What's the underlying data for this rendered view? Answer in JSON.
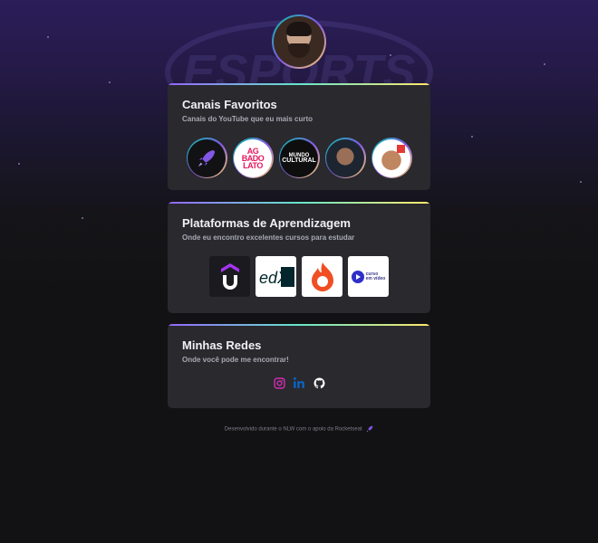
{
  "profile": {
    "avatar_icon": "avatar-photo"
  },
  "sections": {
    "channels": {
      "title": "Canais Favoritos",
      "subtitle": "Canais do YouTube que eu mais curto",
      "items": [
        {
          "icon": "rocketseat-logo"
        },
        {
          "label_lines": [
            "AG",
            "BADO",
            "LATO"
          ]
        },
        {
          "label_lines": [
            "MUNDO",
            "CULTURAL"
          ]
        },
        {
          "icon": "channel-avatar"
        },
        {
          "icon": "channel-avatar"
        }
      ]
    },
    "platforms": {
      "title": "Plataformas de Aprendizagem",
      "subtitle": "Onde eu encontro excelentes cursos para estudar",
      "items": [
        {
          "icon": "udemy-logo"
        },
        {
          "label": "edX"
        },
        {
          "icon": "hotmart-logo"
        },
        {
          "label_lines": [
            "curso",
            "em vídeo"
          ]
        }
      ]
    },
    "socials": {
      "title": "Minhas Redes",
      "subtitle": "Onde você pode me encontrar!",
      "items": [
        {
          "icon": "instagram-icon",
          "color": "#e02ebd"
        },
        {
          "icon": "linkedin-icon",
          "color": "#0a66c2"
        },
        {
          "icon": "github-icon",
          "color": "#ffffff"
        }
      ]
    }
  },
  "footer": {
    "text": "Desenvolvido durante o NLW com o apoio da Rocketseat"
  },
  "colors": {
    "accent": "#8257e5",
    "card": "#29292e",
    "background": "#121214"
  }
}
